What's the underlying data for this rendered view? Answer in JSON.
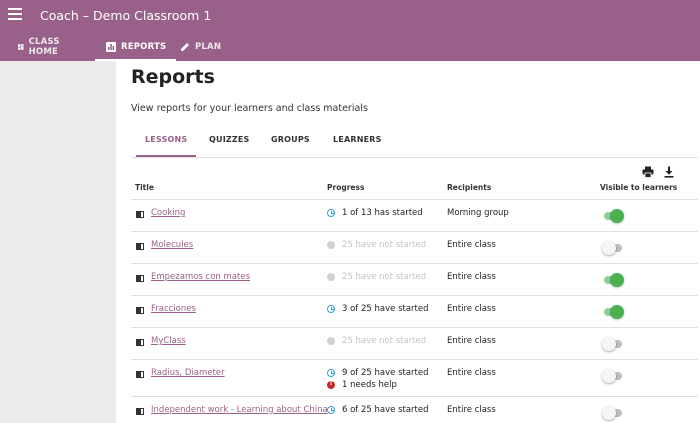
{
  "app": {
    "title": "Coach – Demo Classroom 1"
  },
  "nav": [
    {
      "label": "CLASS HOME",
      "icon": "dashboard-icon",
      "active": false
    },
    {
      "label": "REPORTS",
      "icon": "bar-chart-icon",
      "active": true
    },
    {
      "label": "PLAN",
      "icon": "pencil-icon",
      "active": false
    }
  ],
  "page": {
    "title": "Reports",
    "subtitle": "View reports for your learners and class materials"
  },
  "tabs": [
    {
      "label": "LESSONS",
      "active": true
    },
    {
      "label": "QUIZZES",
      "active": false
    },
    {
      "label": "GROUPS",
      "active": false
    },
    {
      "label": "LEARNERS",
      "active": false
    }
  ],
  "table": {
    "headers": {
      "title": "Title",
      "progress": "Progress",
      "recipients": "Recipients",
      "visible": "Visible to learners"
    },
    "rows": [
      {
        "title": "Cooking",
        "progress": "1 of 13 has started",
        "progress_state": "started",
        "recipients": "Morning group",
        "visible": true
      },
      {
        "title": "Molecules",
        "progress": "25 have not started",
        "progress_state": "not_started",
        "recipients": "Entire class",
        "visible": false
      },
      {
        "title": "Empezamos con mates",
        "progress": "25 have not started",
        "progress_state": "not_started",
        "recipients": "Entire class",
        "visible": true
      },
      {
        "title": "Fracciones",
        "progress": "3 of 25 have started",
        "progress_state": "started",
        "recipients": "Entire class",
        "visible": true
      },
      {
        "title": "MyClass",
        "progress": "25 have not started",
        "progress_state": "not_started",
        "recipients": "Entire class",
        "visible": false
      },
      {
        "title": "Radius, Diameter",
        "progress": "9 of 25 have started",
        "progress_state": "started",
        "help": "1 needs help",
        "recipients": "Entire class",
        "visible": false
      },
      {
        "title": "Independent work - Learning about China",
        "progress": "6 of 25 have started",
        "progress_state": "started",
        "recipients": "Entire class",
        "visible": false
      }
    ]
  },
  "colors": {
    "brand": "#996189",
    "toggle_on": "#4caf50",
    "progress_icon": "#2aa0d6",
    "help_icon": "#c62828"
  }
}
